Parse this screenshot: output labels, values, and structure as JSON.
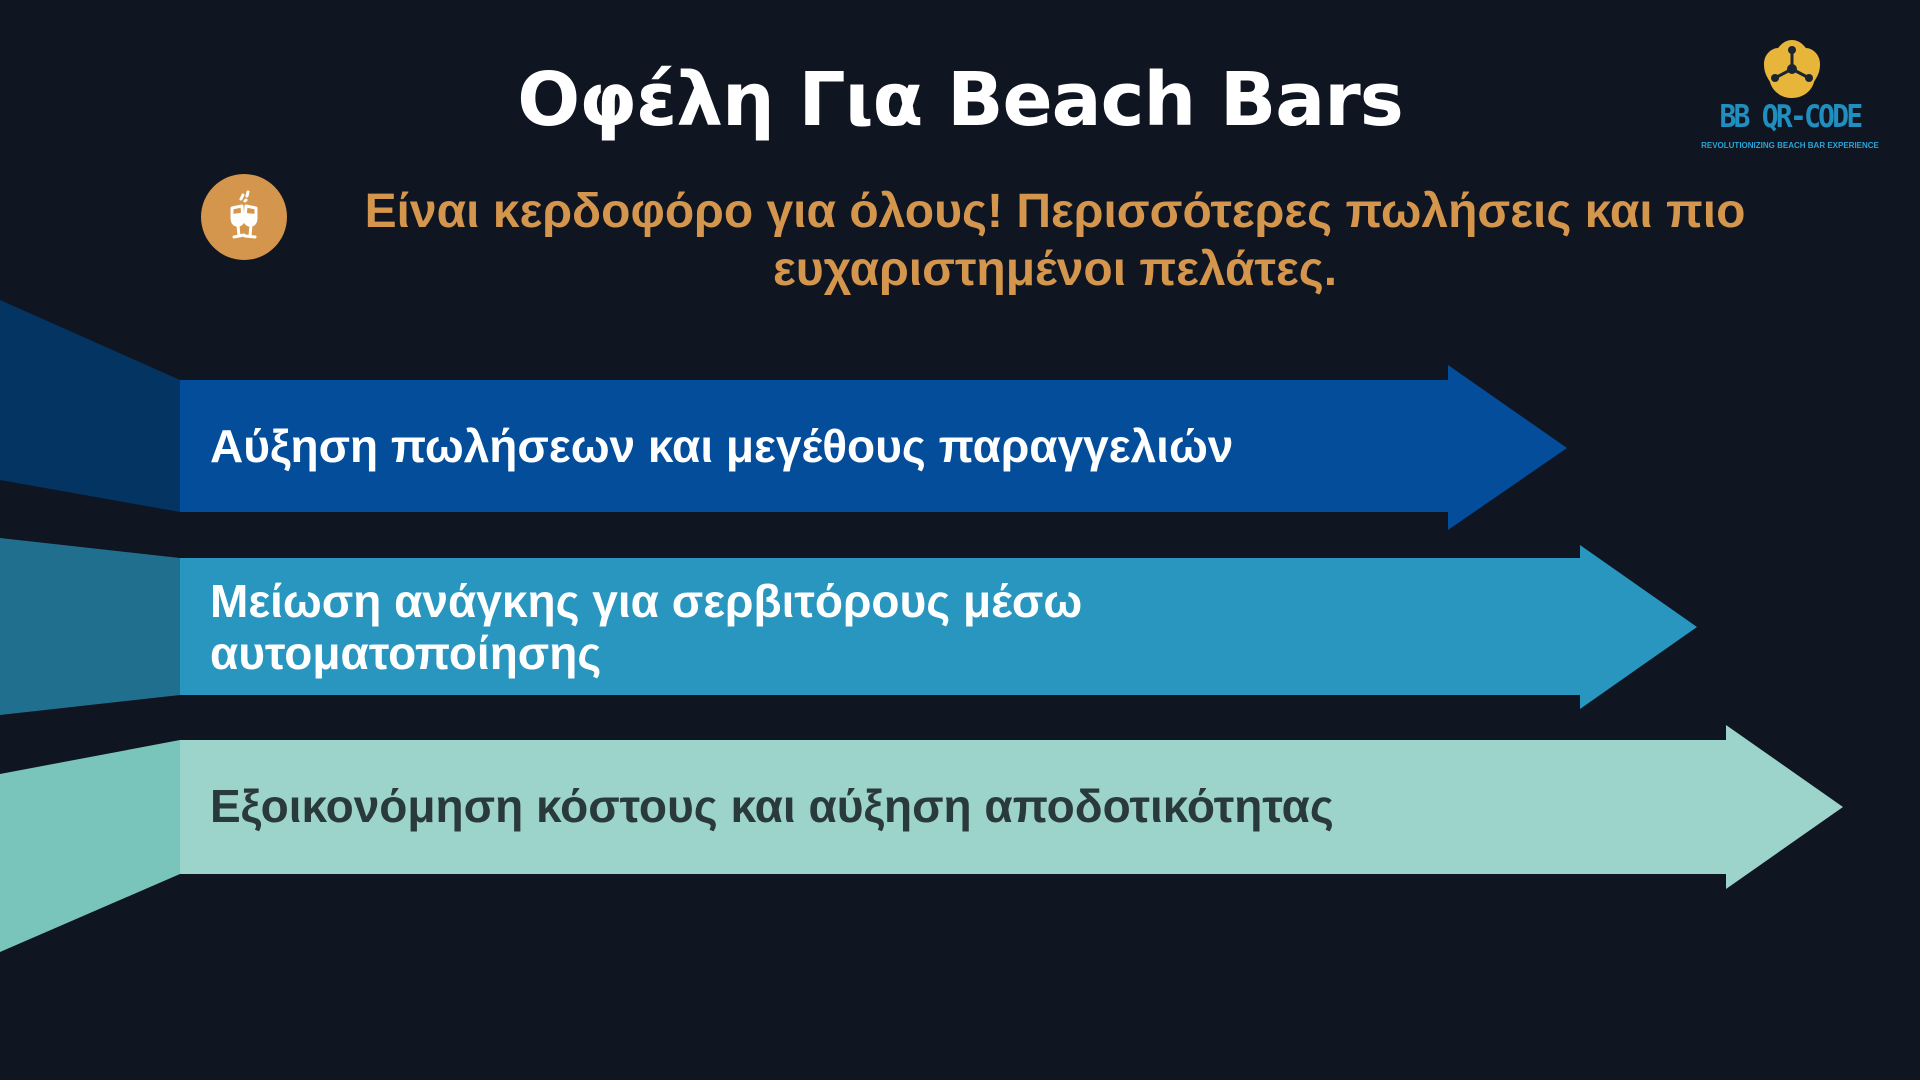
{
  "slide": {
    "title": "Οφέλη Για Beach Bars",
    "subtitle": "Είναι κερδοφόρο για όλους! Περισσότερες πωλήσεις και πιο ευχαριστημένοι πελάτες.",
    "subtitle_icon": "champagne-glasses-icon"
  },
  "logo": {
    "name": "BB QR-CODE",
    "tagline": "REVOLUTIONIZING BEACH BAR EXPERIENCE"
  },
  "benefits": [
    {
      "label": "Αύξηση πωλήσεων και μεγέθους παραγγελιών",
      "color": "#034d9a"
    },
    {
      "label": "Μείωση ανάγκης για σερβιτόρους μέσω αυτοματοποίησης",
      "color": "#2896bf"
    },
    {
      "label": "Εξοικονόμηση κόστους και αύξηση αποδοτικότητας",
      "color": "#9cd4cb"
    }
  ],
  "colors": {
    "background": "#101522",
    "accent": "#d4954c",
    "title": "#ffffff"
  }
}
